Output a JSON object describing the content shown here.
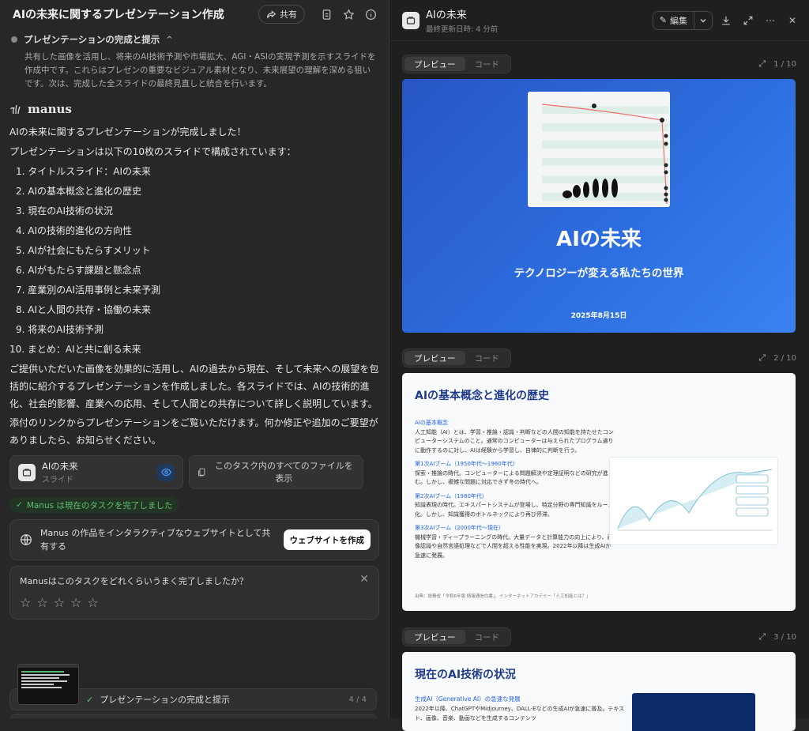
{
  "left": {
    "title": "AIの未来に関するプレゼンテーション作成",
    "share_label": "共有",
    "step": {
      "title": "プレゼンテーションの完成と提示",
      "desc": "共有した画像を活用し、将来のAI技術予測や市場拡大、AGI・ASIの実現予測を示すスライドを作成中です。これらはプレゼンの重要なビジュアル素材となり、未来展望の理解を深める狙いです。次は、完成した全スライドの最終見直しと統合を行います。"
    },
    "brand": "manus",
    "message": {
      "intro": "AIの未来に関するプレゼンテーションが完成しました！",
      "lead": "プレゼンテーションは以下の10枚のスライドで構成されています：",
      "items": [
        "1. タイトルスライド：AIの未来",
        "2. AIの基本概念と進化の歴史",
        "3. 現在のAI技術の状況",
        "4. AIの技術的進化の方向性",
        "5. AIが社会にもたらすメリット",
        "6. AIがもたらす課題と懸念点",
        "7. 産業別のAI活用事例と未来予測",
        "8. AIと人間の共存・協働の未来",
        "9. 将来のAI技術予測",
        "10. まとめ：AIと共に創る未来"
      ],
      "para1": "ご提供いただいた画像を効果的に活用し、AIの過去から現在、そして未来への展望を包括的に紹介するプレゼンテーションを作成しました。各スライドでは、AIの技術的進化、社会的影響、産業への応用、そして人間との共存について詳しく説明しています。",
      "para2": "添付のリンクからプレゼンテーションをご覧いただけます。何か修正や追加のご要望がありましたら、お知らせください。"
    },
    "file_card": {
      "name": "AIの未来",
      "type": "スライド"
    },
    "all_files_label": "このタスク内のすべてのファイルを表示",
    "done_label": "Manus は現在のタスクを完了しました",
    "web_share": {
      "text": "Manus の作品をインタラクティブなウェブサイトとして共有する",
      "button": "ウェブサイトを作成"
    },
    "rating": {
      "question": "Manusはこのタスクをどれくらいうまく完了しましたか？"
    },
    "bottom": {
      "label": "プレゼンテーションの完成と提示",
      "count": "4 / 4"
    }
  },
  "right": {
    "title": "AIの未来",
    "subtitle": "最終更新日時: 4 分前",
    "edit_label": "編集",
    "tab_preview": "プレビュー",
    "tab_code": "コード",
    "slides": [
      {
        "count": "1 / 10",
        "title": "AIの未来",
        "subtitle": "テクノロジーが変える私たちの世界",
        "date": "2025年8月15日"
      },
      {
        "count": "2 / 10",
        "title": "AIの基本概念と進化の歴史",
        "sections": [
          {
            "h": "AIの基本概念",
            "p": "人工知能（AI）とは、学習・推論・認識・判断などの人間の知能を持たせたコンピューターシステムのこと。通常のコンピューターは与えられたプログラム通りに動作するのに対し、AIは経験から学習し、自律的に判断を行う。"
          },
          {
            "h": "第1次AIブーム（1950年代〜1960年代）",
            "p": "探索・推論の時代。コンピューターによる問題解決や定理証明などの研究が進む。しかし、複雑な問題に対応できず冬の時代へ。"
          },
          {
            "h": "第2次AIブーム（1980年代）",
            "p": "知識表現の時代。エキスパートシステムが登場し、特定分野の専門知識をルール化。しかし、知識獲得のボトルネックにより再び停滞。"
          },
          {
            "h": "第3次AIブーム（2000年代〜現在）",
            "p": "機械学習・ディープラーニングの時代。大量データと計算能力の向上により、画像認識や自然言語処理などで人間を超える性能を実現。2022年以降は生成AIが急速に発展。"
          }
        ],
        "source": "出典：総務省「令和6年版 情報通信白書」、インターネットアカデミー「人工知能とは？」"
      },
      {
        "count": "3 / 10",
        "title": "現在のAI技術の状況",
        "section_h": "生成AI（Generative AI）の急速な発展",
        "section_p": "2022年以降、ChatGPTやMidjourney、DALL-Eなどの生成AIが急速に普及。テキスト、画像、音楽、動画などを生成するコンテンツ"
      }
    ]
  },
  "colors": {
    "accent": "#2d6fe0",
    "success": "#5cc16a",
    "slide_title": "#1e3a8a",
    "link": "#2563eb"
  }
}
